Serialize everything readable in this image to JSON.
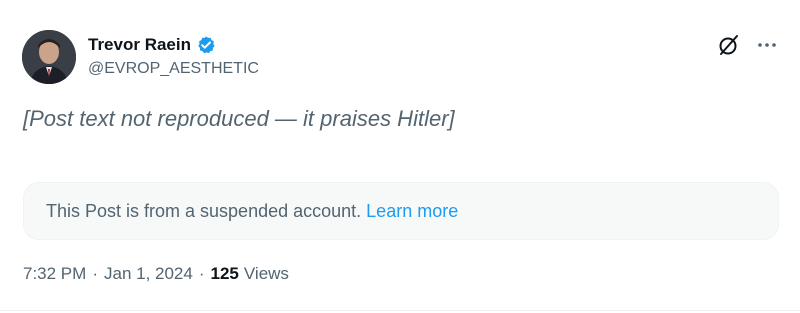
{
  "author": {
    "display_name": "Trevor Raein",
    "handle": "@EVROP_AESTHETIC",
    "verified": true
  },
  "post": {
    "text": "[Post text not reproduced — it praises Hitler]",
    "link_text": "",
    "suspended_notice": "This Post is from a suspended account.",
    "learn_more_label": "Learn more",
    "time": "7:32 PM",
    "date": "Jan 1, 2024",
    "views_count": "125",
    "views_label": "Views"
  },
  "icons": {
    "verified": "verified-badge-icon",
    "grok": "grok-icon",
    "more": "more-options-icon"
  },
  "colors": {
    "accent": "#1d9bf0",
    "text": "#0f1419",
    "muted": "#536471",
    "notice_bg": "#f7f9f9"
  }
}
